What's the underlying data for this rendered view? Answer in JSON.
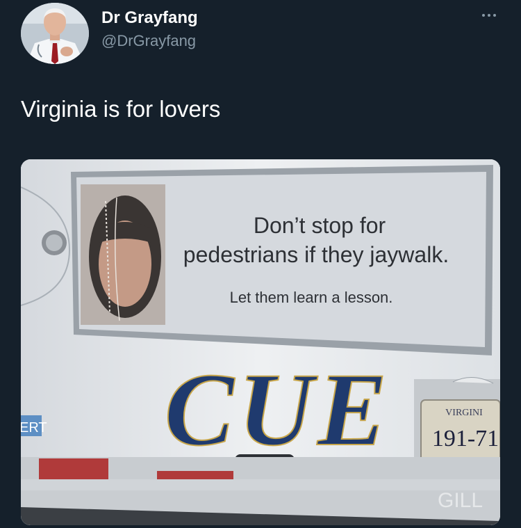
{
  "tweet": {
    "display_name": "Dr Grayfang",
    "handle": "@DrGrayfang",
    "text": "Virginia is for lovers",
    "more_icon": "more-horizontal-icon"
  },
  "media": {
    "ad_line1": "Don’t stop for",
    "ad_line2": "pedestrians if they jaywalk.",
    "ad_line3": "Let them learn a lesson.",
    "bus_logo": "CUE",
    "plate_state": "VIRGINI",
    "plate_number": "191-71",
    "side_text": "ERT",
    "bottom_text": "GILL"
  },
  "colors": {
    "background": "#15202b",
    "secondary_text": "#8899a6",
    "cue_blue": "#1f3a6e"
  }
}
